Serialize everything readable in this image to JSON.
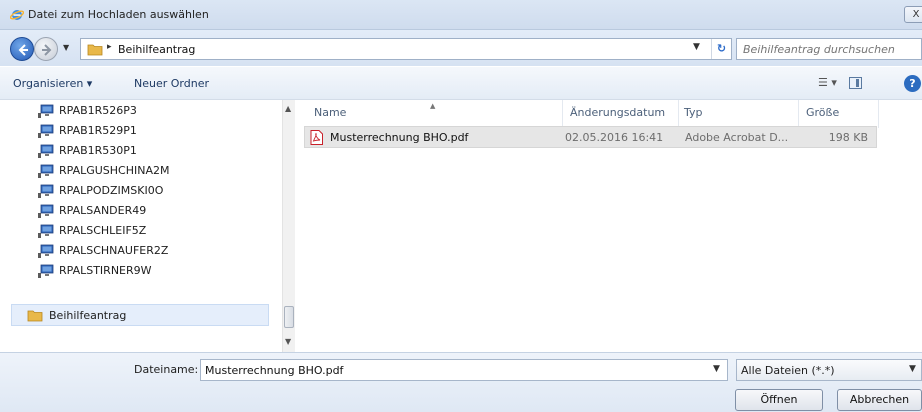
{
  "window": {
    "title": "Datei zum Hochladen auswählen",
    "close_label": "X"
  },
  "addressbar": {
    "breadcrumb": "Beihilfeantrag",
    "search_placeholder": "Beihilfeantrag durchsuchen"
  },
  "toolbar": {
    "organize_label": "Organisieren ▾",
    "new_folder_label": "Neuer Ordner"
  },
  "nav_pane": {
    "items": [
      {
        "label": "RPAB1R526P3"
      },
      {
        "label": "RPAB1R529P1"
      },
      {
        "label": "RPAB1R530P1"
      },
      {
        "label": "RPALGUSHCHINA2M"
      },
      {
        "label": "RPALPODZIMSKI0O"
      },
      {
        "label": "RPALSANDER49"
      },
      {
        "label": "RPALSCHLEIF5Z"
      },
      {
        "label": "RPALSCHNAUFER2Z"
      },
      {
        "label": "RPALSTIRNER9W"
      }
    ],
    "selected": {
      "label": "Beihilfeantrag"
    }
  },
  "file_list": {
    "columns": {
      "name": "Name",
      "date": "Änderungsdatum",
      "type": "Typ",
      "size": "Größe"
    },
    "rows": [
      {
        "name": "Musterrechnung BHO.pdf",
        "date": "02.05.2016 16:41",
        "type": "Adobe Acrobat D...",
        "size": "198 KB"
      }
    ]
  },
  "footer": {
    "filename_label": "Dateiname:",
    "filename_value": "Musterrechnung BHO.pdf",
    "filter_label": "Alle Dateien (*.*)",
    "open_label": "Öffnen",
    "cancel_label": "Abbrechen"
  },
  "colors": {
    "accent": "#2c6cc0",
    "selection": "#e5eefb",
    "pdf_red": "#c8202a"
  }
}
